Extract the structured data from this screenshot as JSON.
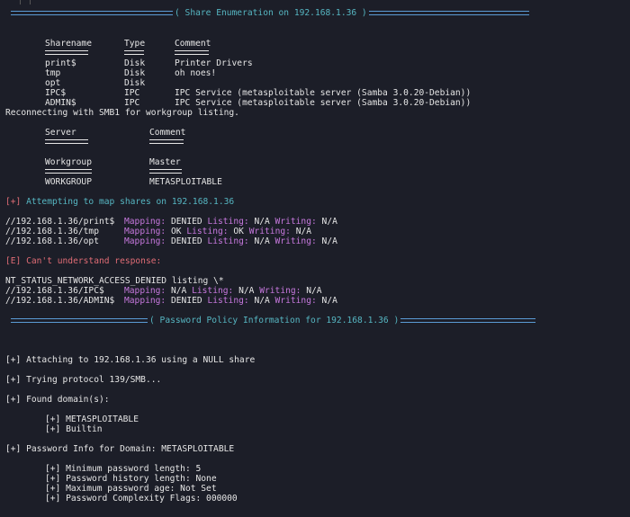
{
  "share_enum": {
    "title": "( Share Enumeration on 192.168.1.36 )",
    "headers": [
      "Sharename",
      "Type",
      "Comment"
    ],
    "rows": [
      [
        "print$",
        "Disk",
        "Printer Drivers"
      ],
      [
        "tmp",
        "Disk",
        "oh noes!"
      ],
      [
        "opt",
        "Disk",
        ""
      ],
      [
        "IPC$",
        "IPC",
        "IPC Service (metasploitable server (Samba 3.0.20-Debian))"
      ],
      [
        "ADMIN$",
        "IPC",
        "IPC Service (metasploitable server (Samba 3.0.20-Debian))"
      ]
    ],
    "reconnect": "Reconnecting with SMB1 for workgroup listing.",
    "server_headers": [
      "Server",
      "Comment"
    ],
    "wg_headers": [
      "Workgroup",
      "Master"
    ],
    "wg_row": [
      "WORKGROUP",
      "METASPLOITABLE"
    ],
    "attempt": {
      "marker": "[+]",
      "text": " Attempting to map shares on 192.168.1.36"
    },
    "mappings": [
      {
        "path": "//192.168.1.36/print$",
        "mapping": "DENIED",
        "listing": "N/A",
        "writing": "N/A"
      },
      {
        "path": "//192.168.1.36/tmp",
        "mapping": "OK",
        "listing": "OK",
        "writing": "N/A"
      },
      {
        "path": "//192.168.1.36/opt",
        "mapping": "DENIED",
        "listing": "N/A",
        "writing": "N/A"
      }
    ],
    "error": {
      "marker": "[E]",
      "text": " Can't understand response:"
    },
    "nt_status": "NT_STATUS_NETWORK_ACCESS_DENIED listing \\*",
    "mappings2": [
      {
        "path": "//192.168.1.36/IPC$",
        "mapping": "N/A",
        "listing": "N/A",
        "writing": "N/A"
      },
      {
        "path": "//192.168.1.36/ADMIN$",
        "mapping": "DENIED",
        "listing": "N/A",
        "writing": "N/A"
      }
    ],
    "labels": {
      "mapping": "Mapping:",
      "listing": "Listing:",
      "writing": "Writing:"
    }
  },
  "policy": {
    "title": "( Password Policy Information for 192.168.1.36 )",
    "attaching": "[+] Attaching to 192.168.1.36 using a NULL share",
    "trying": "[+] Trying protocol 139/SMB...",
    "found": "[+] Found domain(s):",
    "domains": [
      "[+] METASPLOITABLE",
      "[+] Builtin"
    ],
    "pw_info": "[+] Password Info for Domain: METASPLOITABLE",
    "details": [
      "[+] Minimum password length: 5",
      "[+] Password history length: None",
      "[+] Maximum password age: Not Set",
      "[+] Password Complexity Flags: 000000"
    ]
  },
  "colors": {
    "background": "#1c1e28",
    "accent": "#5b9bd5",
    "label": "#c678dd",
    "info": "#56b6c2",
    "error": "#e06c75"
  }
}
